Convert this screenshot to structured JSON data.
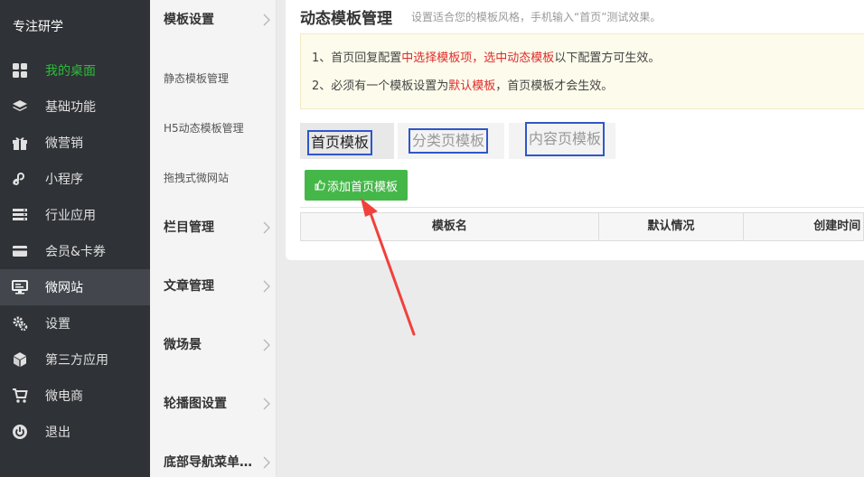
{
  "sidebar": {
    "brand": "专注研学",
    "items": [
      {
        "label": "我的桌面",
        "icon": "grid-icon"
      },
      {
        "label": "基础功能",
        "icon": "layers-icon"
      },
      {
        "label": "微营销",
        "icon": "gift-icon"
      },
      {
        "label": "小程序",
        "icon": "miniprogram-icon"
      },
      {
        "label": "行业应用",
        "icon": "list-icon"
      },
      {
        "label": "会员&卡券",
        "icon": "card-icon"
      },
      {
        "label": "微网站",
        "icon": "monitor-icon"
      },
      {
        "label": "设置",
        "icon": "gears-icon"
      },
      {
        "label": "第三方应用",
        "icon": "cube-icon"
      },
      {
        "label": "微电商",
        "icon": "cart-icon"
      },
      {
        "label": "退出",
        "icon": "power-icon"
      }
    ]
  },
  "submenu": {
    "items": [
      {
        "label": "模板设置",
        "type": "group"
      },
      {
        "label": "静态模板管理",
        "type": "child"
      },
      {
        "label": "H5动态模板管理",
        "type": "child"
      },
      {
        "label": "拖拽式微网站",
        "type": "child"
      },
      {
        "label": "栏目管理",
        "type": "group"
      },
      {
        "label": "文章管理",
        "type": "group"
      },
      {
        "label": "微场景",
        "type": "group"
      },
      {
        "label": "轮播图设置",
        "type": "group"
      },
      {
        "label": "底部导航菜单…",
        "type": "group"
      }
    ]
  },
  "main": {
    "title": "动态模板管理",
    "subtitle": "设置适合您的模板风格，手机输入“首页”测试效果。",
    "notice": {
      "line1": {
        "a": "1、首页回复配置",
        "b": "中选择模板项，选中",
        "c": "动态模板",
        "d": "以下配置方可生效。"
      },
      "line2": {
        "a": "2、必须有一个模板设置为",
        "b": "默认模板",
        "c": "，首页模板才会生效。"
      }
    },
    "tabs": [
      {
        "label": "首页模板",
        "active": true
      },
      {
        "label": "分类页模板",
        "active": false
      },
      {
        "label": "内容页模板",
        "active": false
      }
    ],
    "add_button": "添加首页模板",
    "table": {
      "columns": [
        "模板名",
        "默认情况",
        "创建时间"
      ]
    }
  },
  "colors": {
    "sidebar_bg": "#2f3236",
    "active_green": "#2bbb3a",
    "button_green": "#45b749",
    "highlight_red": "#e02b2b",
    "annotation_blue": "#2f57c9",
    "arrow_red": "#f0413c"
  }
}
